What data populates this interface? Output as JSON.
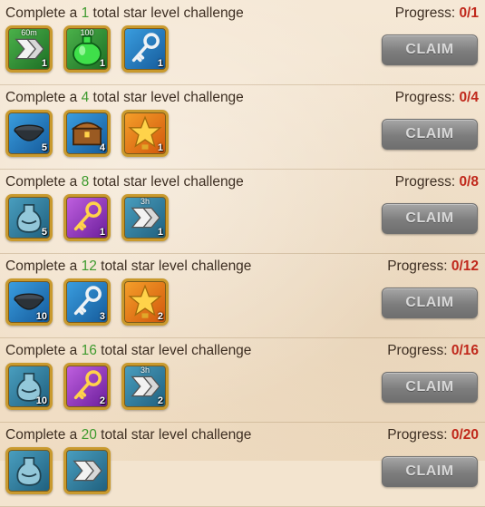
{
  "rows": [
    {
      "prefix": "Complete a ",
      "num": "1",
      "suffix": " total star level challenge",
      "progress_label": "Progress: ",
      "progress_value": "0/1",
      "claim": "CLAIM",
      "items": [
        {
          "icon": "speedup-icon",
          "bg": "green",
          "qty": "1",
          "tag": "60m"
        },
        {
          "icon": "green-potion-icon",
          "bg": "green",
          "qty": "1",
          "tag": "100"
        },
        {
          "icon": "silver-key-icon",
          "bg": "blue",
          "qty": "1"
        }
      ]
    },
    {
      "prefix": "Complete a ",
      "num": "4",
      "suffix": " total star level challenge",
      "progress_label": "Progress: ",
      "progress_value": "0/4",
      "claim": "CLAIM",
      "items": [
        {
          "icon": "bowl-icon",
          "bg": "blue",
          "qty": "5"
        },
        {
          "icon": "treasure-chest-icon",
          "bg": "blue",
          "qty": "4"
        },
        {
          "icon": "star-trophy-icon",
          "bg": "orange",
          "qty": "1"
        }
      ]
    },
    {
      "prefix": "Complete a ",
      "num": "8",
      "suffix": " total star level challenge",
      "progress_label": "Progress: ",
      "progress_value": "0/8",
      "claim": "CLAIM",
      "items": [
        {
          "icon": "bottle-icon",
          "bg": "teal",
          "qty": "5"
        },
        {
          "icon": "gold-key-icon",
          "bg": "purple",
          "qty": "1"
        },
        {
          "icon": "speedup-icon",
          "bg": "teal",
          "qty": "1",
          "tag": "3h"
        }
      ]
    },
    {
      "prefix": "Complete a ",
      "num": "12",
      "suffix": " total star level challenge",
      "progress_label": "Progress: ",
      "progress_value": "0/12",
      "claim": "CLAIM",
      "items": [
        {
          "icon": "bowl-icon",
          "bg": "blue",
          "qty": "10"
        },
        {
          "icon": "silver-key-icon",
          "bg": "blue",
          "qty": "3"
        },
        {
          "icon": "star-trophy-icon",
          "bg": "orange",
          "qty": "2"
        }
      ]
    },
    {
      "prefix": "Complete a ",
      "num": "16",
      "suffix": " total star level challenge",
      "progress_label": "Progress: ",
      "progress_value": "0/16",
      "claim": "CLAIM",
      "items": [
        {
          "icon": "bottle-icon",
          "bg": "teal",
          "qty": "10"
        },
        {
          "icon": "gold-key-icon",
          "bg": "purple",
          "qty": "2"
        },
        {
          "icon": "speedup-icon",
          "bg": "teal",
          "qty": "2",
          "tag": "3h"
        }
      ]
    },
    {
      "prefix": "Complete a ",
      "num": "20",
      "suffix": " total star level challenge",
      "progress_label": "Progress: ",
      "progress_value": "0/20",
      "claim": "CLAIM",
      "items": [
        {
          "icon": "bottle-icon",
          "bg": "teal",
          "qty": ""
        },
        {
          "icon": "speedup-icon",
          "bg": "teal",
          "qty": ""
        }
      ]
    }
  ],
  "colors": {
    "number_green": "#3e9a2e",
    "progress_red": "#c0281b",
    "claim_disabled": "#7d7d7d"
  }
}
